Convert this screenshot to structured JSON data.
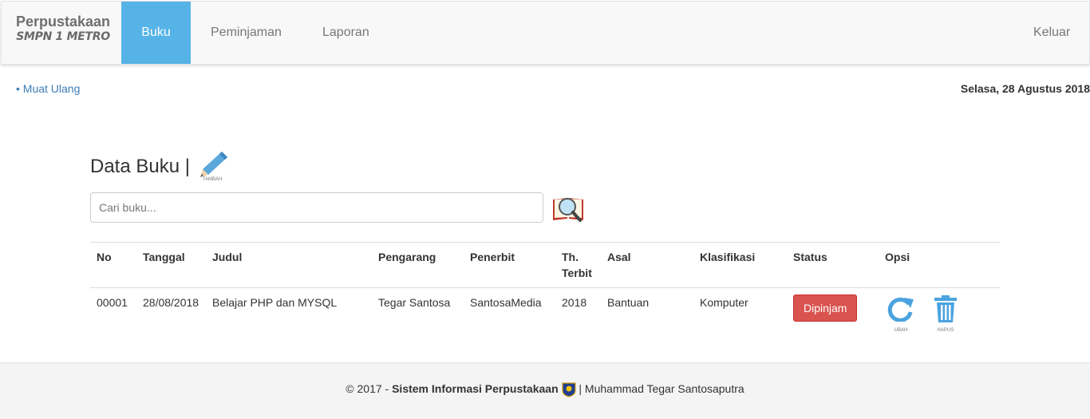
{
  "brand": {
    "title": "Perpustakaan",
    "subtitle": "SMPN 1 METRO"
  },
  "nav": {
    "items": [
      "Buku",
      "Peminjaman",
      "Laporan"
    ],
    "logout": "Keluar"
  },
  "subbar": {
    "reload": "• Muat Ulang",
    "date": "Selasa, 28 Agustus 2018"
  },
  "page": {
    "title": "Data Buku |",
    "add_label": "TAMBAH"
  },
  "search": {
    "placeholder": "Cari buku..."
  },
  "table": {
    "headers": [
      "No",
      "Tanggal",
      "Judul",
      "Pengarang",
      "Penerbit",
      "Th. Terbit",
      "Asal",
      "Klasifikasi",
      "Status",
      "Opsi"
    ],
    "rows": [
      {
        "no": "00001",
        "tanggal": "28/08/2018",
        "judul": "Belajar PHP dan MYSQL",
        "pengarang": "Tegar Santosa",
        "penerbit": "SantosaMedia",
        "th_terbit": "2018",
        "asal": "Bantuan",
        "klasifikasi": "Komputer",
        "status": "Dipinjam",
        "edit_label": "UBAH",
        "delete_label": "HAPUS"
      }
    ]
  },
  "footer": {
    "prefix": "© 2017 -",
    "app_name": "Sistem Informasi Perpustakaan",
    "suffix": "| Muhammad Tegar Santosaputra"
  },
  "colors": {
    "active_nav": "#55b3e8",
    "status_danger": "#d9534f",
    "link": "#3c7cb8",
    "icon_blue": "#4aa3df"
  },
  "icons": {
    "add": "pencil-icon",
    "search": "book-search-icon",
    "edit": "refresh-icon",
    "delete": "trash-icon",
    "footer": "school-logo-icon"
  }
}
